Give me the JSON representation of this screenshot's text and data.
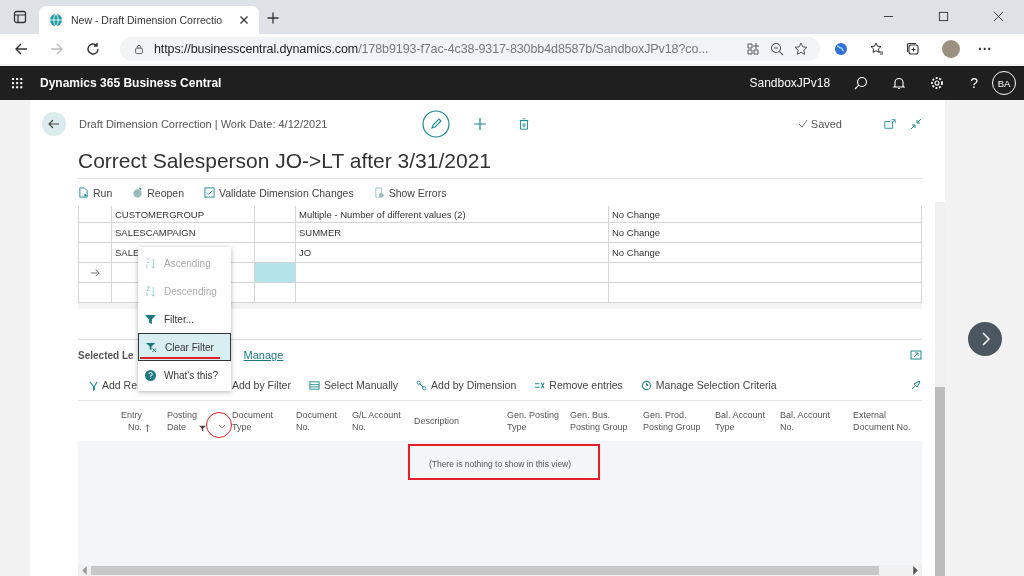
{
  "browser": {
    "tab_title": "New - Draft Dimension Correctio",
    "url_host": "https://businesscentral.dynamics.com",
    "url_path": "/178b9193-f7ac-4c38-9317-830bb4d8587b/SandboxJPv18?co...",
    "more": "···"
  },
  "app_bar": {
    "title": "Dynamics 365 Business Central",
    "environment": "SandboxJPv18",
    "help": "?",
    "avatar": "BA"
  },
  "page": {
    "breadcrumb": "Draft Dimension Correction | Work Date: 4/12/2021",
    "status": "Saved",
    "title": "Correct Salesperson JO->LT after 3/31/2021"
  },
  "actions": [
    {
      "label": "Run"
    },
    {
      "label": "Reopen"
    },
    {
      "label": "Validate Dimension Changes"
    },
    {
      "label": "Show Errors"
    }
  ],
  "dimension_rows": [
    {
      "current": false,
      "code": "CUSTOMERGROUP",
      "new_value": "Multiple - Number of different values (2)",
      "change": "No Change"
    },
    {
      "current": false,
      "code": "SALESCAMPAIGN",
      "new_value": "SUMMER",
      "change": "No Change"
    },
    {
      "current": false,
      "code": "SALE",
      "new_value": "JO",
      "change": "No Change"
    },
    {
      "current": true,
      "code": "",
      "new_value": "",
      "change": ""
    },
    {
      "current": false,
      "code": "",
      "new_value": "",
      "change": ""
    }
  ],
  "context_menu": [
    {
      "label": "Ascending",
      "kind": "sort-asc",
      "disabled": true,
      "selected": false
    },
    {
      "label": "Descending",
      "kind": "sort-desc",
      "disabled": true,
      "selected": false
    },
    {
      "label": "Filter...",
      "kind": "filter",
      "disabled": false,
      "selected": false
    },
    {
      "label": "Clear Filter",
      "kind": "clear-filter",
      "disabled": false,
      "selected": true
    },
    {
      "label": "What's this?",
      "kind": "help",
      "disabled": false,
      "selected": false
    }
  ],
  "section": {
    "title": "Selected Le",
    "link": "Manage"
  },
  "section_actions": [
    {
      "label": "Add Re"
    },
    {
      "label": "Add by Filter"
    },
    {
      "label": "Select Manually"
    },
    {
      "label": "Add by Dimension"
    },
    {
      "label": "Remove entries"
    },
    {
      "label": "Manage Selection Criteria"
    }
  ],
  "columns": [
    {
      "label": "Entry No.",
      "sorted": true,
      "filtered": false
    },
    {
      "label": "Posting Date",
      "sorted": false,
      "filtered": true
    },
    {
      "label": "Document Type",
      "sorted": false,
      "filtered": false
    },
    {
      "label": "Document No.",
      "sorted": false,
      "filtered": false
    },
    {
      "label": "G/L Account No.",
      "sorted": false,
      "filtered": false
    },
    {
      "label": "Description",
      "sorted": false,
      "filtered": false
    },
    {
      "label": "Gen. Posting Type",
      "sorted": false,
      "filtered": false
    },
    {
      "label": "Gen. Bus. Posting Group",
      "sorted": false,
      "filtered": false
    },
    {
      "label": "Gen. Prod. Posting Group",
      "sorted": false,
      "filtered": false
    },
    {
      "label": "Bal. Account Type",
      "sorted": false,
      "filtered": false
    },
    {
      "label": "Bal. Account No.",
      "sorted": false,
      "filtered": false
    },
    {
      "label": "External Document No.",
      "sorted": false,
      "filtered": false
    }
  ],
  "empty_message": "(There is nothing to show in this view)"
}
